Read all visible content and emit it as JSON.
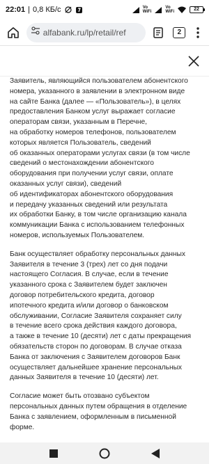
{
  "status_bar": {
    "time": "22:01",
    "speed": "0,8 КБ/с",
    "signal_label_1": "Vo\nWiFi",
    "signal_label_2": "Vo\nWiFi",
    "battery": "22"
  },
  "browser": {
    "url": "alfabank.ru/lp/retail/ref",
    "tab_count": "2"
  },
  "content": {
    "paragraphs": [
      [
        "Заявитель, являющийся пользователем абонентского",
        "номера, указанного в заявлении в электронном виде",
        "на сайте Банка (далее — «Пользователь»), в целях",
        "предоставления Банком услуг выражает согласие",
        "операторам связи, указанным в Перечне,",
        "на обработку номеров телефонов, пользователем",
        "которых является Пользователь, сведений",
        "об оказанных операторами услугах связи (в том числе",
        "сведений о местонахождении абонентского",
        "оборудования при получении услуг связи, оплате",
        "оказанных услуг связи), сведений",
        "об идентификаторах абонентского оборудования",
        "и передачу указанных сведений или результата",
        "их обработки Банку, в том числе организацию канала",
        "коммуникации Банка с использованием телефонных",
        "номеров, используемых Пользователем."
      ],
      [
        "Банк осуществляет обработку персональных данных",
        "Заявителя в течение 3 (трех) лет со дня подачи",
        "настоящего Согласия. В случае, если в течение",
        "указанного срока с Заявителем будет заключен",
        "договор потребительского кредита, договор",
        "ипотечного кредита и/или договор о банковском",
        "обслуживании, Согласие Заявителя сохраняет силу",
        "в течение всего срока действия каждого договора,",
        "а также в течение 10 (десяти) лет с даты прекращения",
        "обязательств сторон по договорам. В случае отказа",
        "Банка от заключения с Заявителем договоров Банк",
        "осуществляет дальнейшее хранение персональных",
        "данных Заявителя в течение 10 (десяти) лет."
      ],
      [
        "Согласие может быть отозвано субъектом",
        "персональных данных путем обращения в отделение",
        "Банка с заявлением, оформленным в письменной",
        "форме."
      ]
    ]
  }
}
